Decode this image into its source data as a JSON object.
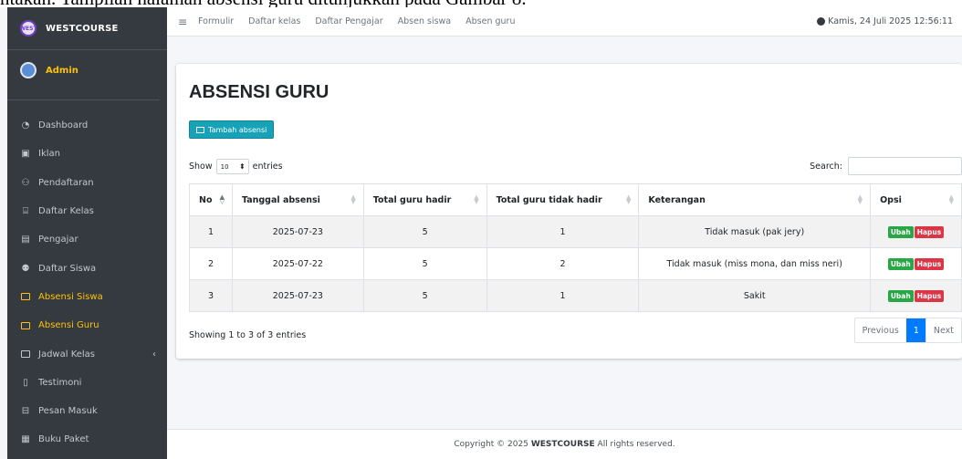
{
  "overlay_text": "ntakan. Tampilan halaman absensi guru ditunjukkan pada Gambar 8.",
  "brand": {
    "name": "WESTCOURSE",
    "logo_text": "WEST"
  },
  "user": {
    "name": "Admin"
  },
  "sidebar": {
    "items": [
      {
        "label": "Dashboard",
        "icon": "dashboard-icon"
      },
      {
        "label": "Iklan",
        "icon": "image-icon"
      },
      {
        "label": "Pendaftaran",
        "icon": "users-icon"
      },
      {
        "label": "Daftar Kelas",
        "icon": "building-icon"
      },
      {
        "label": "Pengajar",
        "icon": "id-card-icon"
      },
      {
        "label": "Daftar Siswa",
        "icon": "user-group-icon"
      },
      {
        "label": "Absensi Siswa",
        "icon": "list-icon"
      },
      {
        "label": "Absensi Guru",
        "icon": "list-icon"
      },
      {
        "label": "Jadwal Kelas",
        "icon": "monitor-icon"
      },
      {
        "label": "Testimoni",
        "icon": "file-icon"
      },
      {
        "label": "Pesan Masuk",
        "icon": "inbox-icon"
      },
      {
        "label": "Buku Paket",
        "icon": "book-icon"
      }
    ]
  },
  "topnav": {
    "links": [
      "Formulir",
      "Daftar kelas",
      "Daftar Pengajar",
      "Absen siswa",
      "Absen guru"
    ],
    "datetime": "Kamis, 24 Juli 2025 12:56:11"
  },
  "page": {
    "title": "ABSENSI GURU",
    "add_button": "Tambah absensi",
    "show_label": "Show",
    "show_value": "10",
    "entries_label": "entries",
    "search_label": "Search:"
  },
  "table": {
    "columns": [
      "No",
      "Tanggal absensi",
      "Total guru hadir",
      "Total guru tidak hadir",
      "Keterangan",
      "Opsi"
    ],
    "rows": [
      {
        "no": "1",
        "tanggal": "2025-07-23",
        "hadir": "5",
        "tidak_hadir": "1",
        "keterangan": "Tidak masuk (pak jery)"
      },
      {
        "no": "2",
        "tanggal": "2025-07-22",
        "hadir": "5",
        "tidak_hadir": "2",
        "keterangan": "Tidak masuk (miss mona, dan miss neri)"
      },
      {
        "no": "3",
        "tanggal": "2025-07-23",
        "hadir": "5",
        "tidak_hadir": "1",
        "keterangan": "Sakit"
      }
    ],
    "edit_label": "Ubah",
    "delete_label": "Hapus"
  },
  "pagination": {
    "info": "Showing 1 to 3 of 3 entries",
    "previous": "Previous",
    "current": "1",
    "next": "Next"
  },
  "footer": {
    "prefix": "Copyright © 2025",
    "brand": "WESTCOURSE",
    "suffix": "All rights reserved."
  },
  "colors": {
    "sidebar_bg": "#343a40",
    "active": "#ffc107",
    "info_button": "#17a2b8",
    "primary": "#007bff",
    "success": "#28a745",
    "danger": "#dc3545"
  }
}
